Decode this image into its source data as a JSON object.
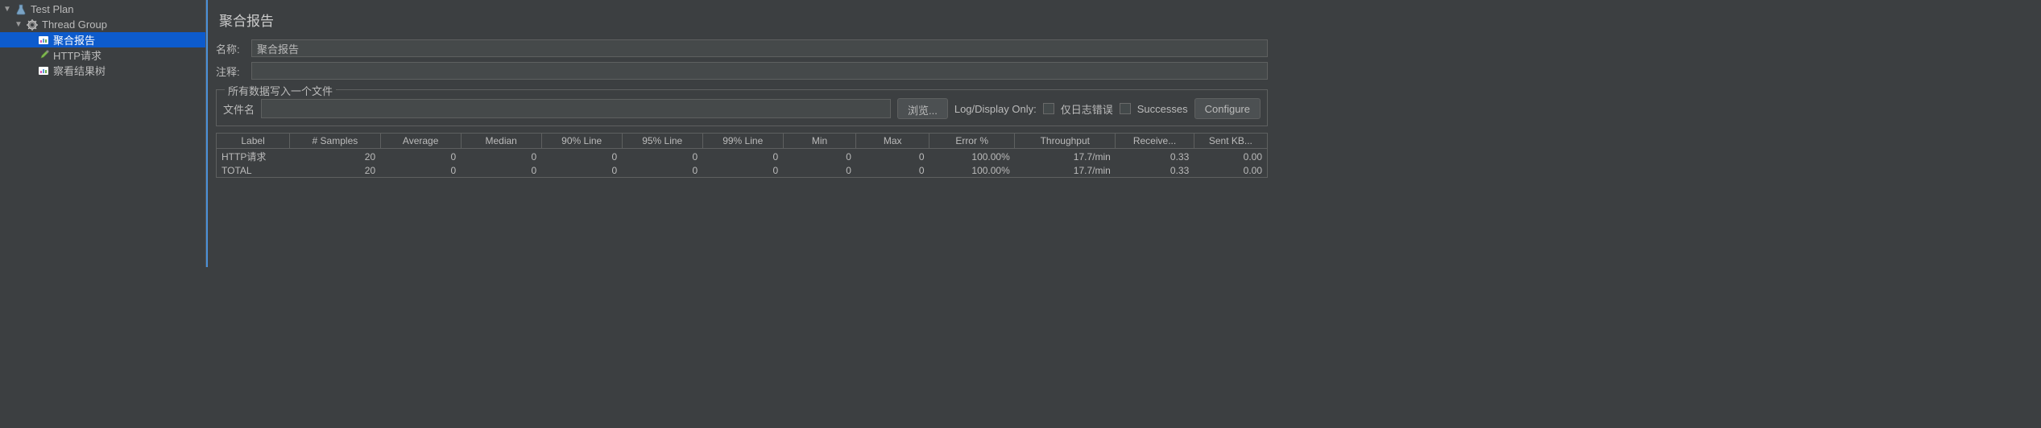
{
  "tree": {
    "root": "Test Plan",
    "group": "Thread Group",
    "items": [
      "聚合报告",
      "HTTP请求",
      "察看结果树"
    ]
  },
  "panel": {
    "title": "聚合报告",
    "name_label": "名称:",
    "name_value": "聚合报告",
    "comment_label": "注释:",
    "comment_value": "",
    "fieldset_legend": "所有数据写入一个文件",
    "file_label": "文件名",
    "file_value": "",
    "browse_btn": "浏览...",
    "log_display": "Log/Display Only:",
    "errors_only": "仅日志错误",
    "successes": "Successes",
    "configure_btn": "Configure"
  },
  "table": {
    "headers": [
      "Label",
      "# Samples",
      "Average",
      "Median",
      "90% Line",
      "95% Line",
      "99% Line",
      "Min",
      "Max",
      "Error %",
      "Throughput",
      "Receive...",
      "Sent KB..."
    ],
    "rows": [
      {
        "label": "HTTP请求",
        "samples": "20",
        "avg": "0",
        "median": "0",
        "p90": "0",
        "p95": "0",
        "p99": "0",
        "min": "0",
        "max": "0",
        "error": "100.00%",
        "throughput": "17.7/min",
        "recv": "0.33",
        "sent": "0.00"
      },
      {
        "label": "TOTAL",
        "samples": "20",
        "avg": "0",
        "median": "0",
        "p90": "0",
        "p95": "0",
        "p99": "0",
        "min": "0",
        "max": "0",
        "error": "100.00%",
        "throughput": "17.7/min",
        "recv": "0.33",
        "sent": "0.00"
      }
    ]
  }
}
